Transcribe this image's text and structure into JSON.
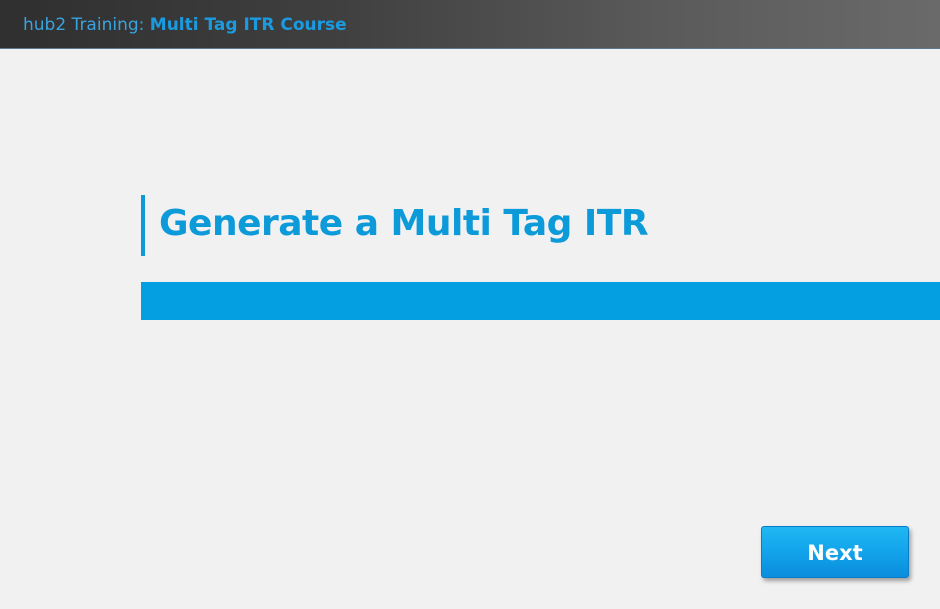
{
  "header": {
    "prefix": "hub2 Training: ",
    "course_name": "Multi Tag ITR Course"
  },
  "slide": {
    "title": "Generate a Multi Tag ITR"
  },
  "navigation": {
    "next_label": "Next"
  },
  "colors": {
    "accent": "#0d9ad9",
    "bar": "#049fe0",
    "background": "#f1f1f2"
  }
}
